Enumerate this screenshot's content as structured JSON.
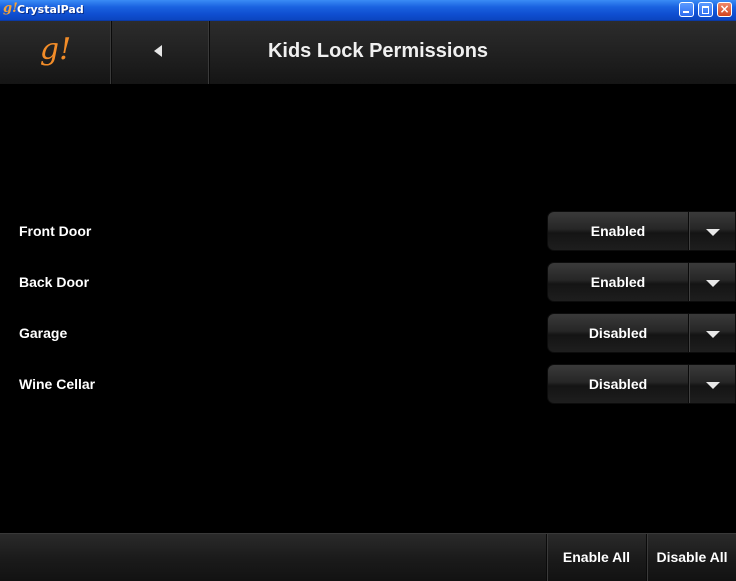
{
  "window": {
    "title": "CrystalPad",
    "icon_glyph": "g!",
    "minimize_icon": "minimize-icon",
    "maximize_icon": "maximize-icon",
    "close_glyph": "×"
  },
  "header": {
    "logo_text": "g!",
    "back_icon": "back-arrow-icon",
    "title": "Kids Lock Permissions"
  },
  "locks": [
    {
      "label": "Front Door",
      "status": "Enabled"
    },
    {
      "label": "Back Door",
      "status": "Enabled"
    },
    {
      "label": "Garage",
      "status": "Disabled"
    },
    {
      "label": "Wine Cellar",
      "status": "Disabled"
    }
  ],
  "footer": {
    "enable_all": "Enable All",
    "disable_all": "Disable All"
  },
  "colors": {
    "brand_accent": "#f28c28",
    "background": "#000000",
    "titlebar": "#1a62e0"
  }
}
